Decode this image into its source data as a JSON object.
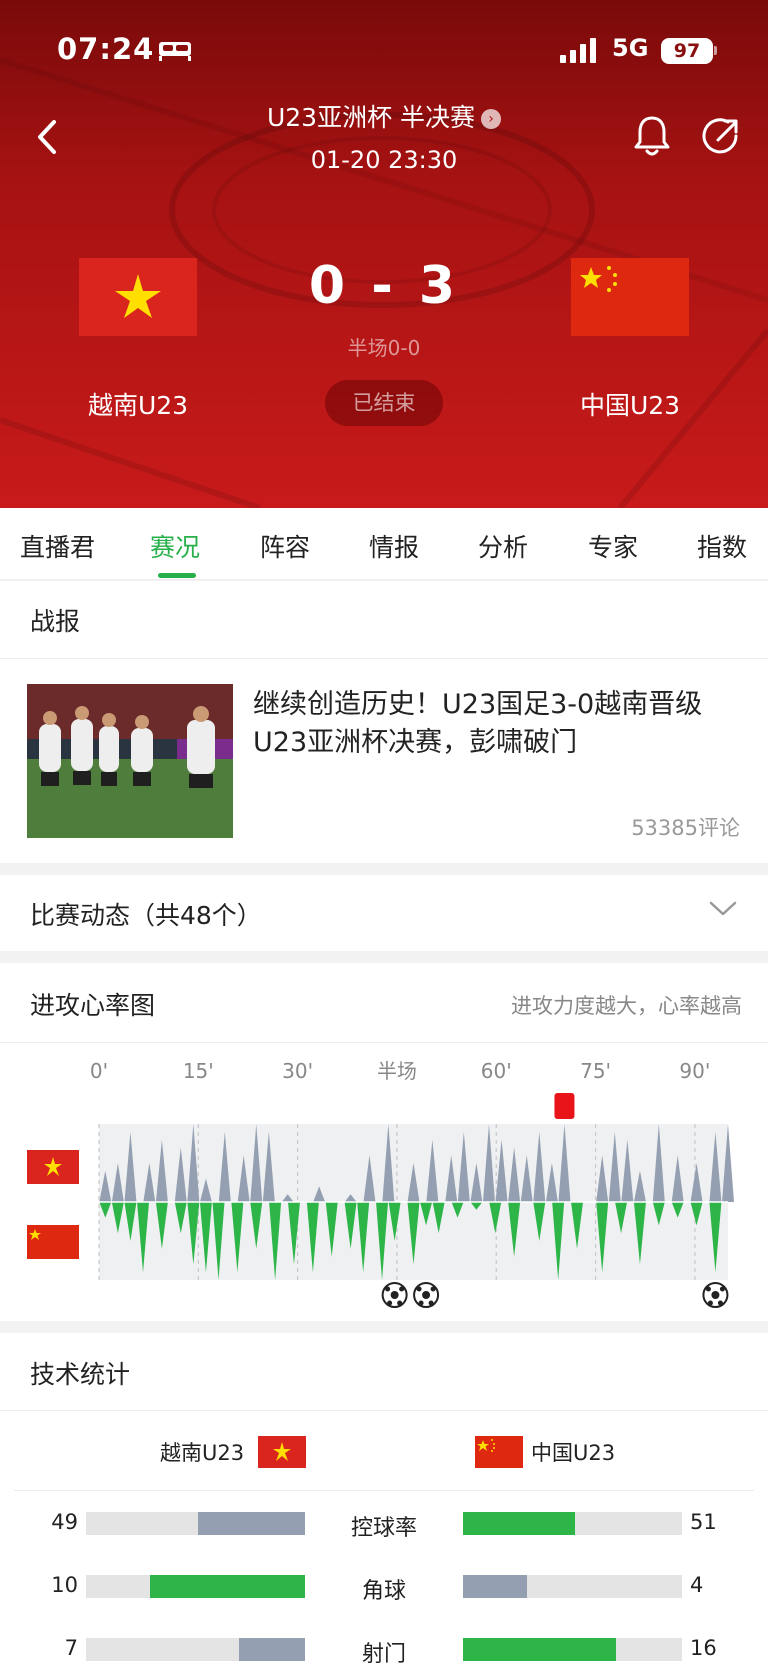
{
  "status_bar": {
    "time": "07:24",
    "network": "5G",
    "battery": "97"
  },
  "header": {
    "league": "U23亚洲杯 半决赛",
    "datetime": "01-20 23:30",
    "home_team": "越南U23",
    "away_team": "中国U23",
    "home_score": "0",
    "away_score": "3",
    "score_sep": "-",
    "halftime": "半场0-0",
    "match_status": "已结束"
  },
  "tabs": [
    "直播君",
    "赛况",
    "阵容",
    "情报",
    "分析",
    "专家",
    "指数"
  ],
  "active_tab": "赛况",
  "report": {
    "section_title": "战报",
    "headline": "继续创造历史！U23国足3-0越南晋级U23亚洲杯决赛，彭啸破门",
    "comments": "53385评论"
  },
  "dynamics": {
    "title": "比赛动态（共48个）"
  },
  "attack_chart": {
    "title": "进攻心率图",
    "subtitle": "进攻力度越大，心率越高",
    "time_labels": [
      "0'",
      "15'",
      "30'",
      "半场",
      "60'",
      "75'",
      "90'"
    ]
  },
  "chart_data": {
    "type": "area",
    "xlabel": "",
    "ylabel": "",
    "x_ticks": [
      "0'",
      "15'",
      "30'",
      "半场",
      "60'",
      "75'",
      "90'"
    ],
    "series": [
      {
        "x": [
          1,
          3,
          5,
          8,
          10,
          13,
          15,
          17,
          20,
          23,
          25,
          27,
          30,
          35,
          40,
          43,
          46,
          50,
          53,
          56,
          58,
          60,
          62,
          64,
          66,
          68,
          70,
          72,
          74,
          80,
          82,
          84,
          86,
          89,
          92,
          95,
          98,
          100
        ],
        "y": [
          0.4,
          0.5,
          0.9,
          0.5,
          0.8,
          0.7,
          1.0,
          0.3,
          0.9,
          0.6,
          1.0,
          0.9,
          0.1,
          0.2,
          0.1,
          0.6,
          1.0,
          0.5,
          0.8,
          0.6,
          0.9,
          0.5,
          1.0,
          0.8,
          0.7,
          0.6,
          0.9,
          0.5,
          1.0,
          0.6,
          0.9,
          0.8,
          0.4,
          1.0,
          0.6,
          0.5,
          0.9,
          1.0
        ]
      },
      {
        "x": [
          1,
          3,
          5,
          7,
          10,
          13,
          15,
          17,
          19,
          22,
          25,
          28,
          31,
          34,
          37,
          40,
          42,
          45,
          47,
          50,
          52,
          54,
          57,
          60,
          63,
          66,
          70,
          73,
          76,
          80,
          83,
          86,
          89,
          92,
          95,
          98
        ],
        "y": [
          0.2,
          0.4,
          0.5,
          0.9,
          0.6,
          0.4,
          0.8,
          0.9,
          1.0,
          0.9,
          0.6,
          1.0,
          0.8,
          0.9,
          0.7,
          0.6,
          0.9,
          1.0,
          0.5,
          0.8,
          0.3,
          0.4,
          0.2,
          0.1,
          0.4,
          0.7,
          0.5,
          1.0,
          0.6,
          0.9,
          0.4,
          0.8,
          0.3,
          0.2,
          0.3,
          0.9
        ]
      }
    ],
    "events": [
      {
        "type": "goal",
        "team": "away",
        "minute": 47
      },
      {
        "type": "goal",
        "team": "away",
        "minute": 52
      },
      {
        "type": "goal",
        "team": "away",
        "minute": 98
      },
      {
        "type": "red_card",
        "team": "home",
        "minute": 74
      }
    ]
  },
  "stats": {
    "title": "技术统计",
    "home_name": "越南U23",
    "away_name": "中国U23",
    "rows": [
      {
        "label": "控球率",
        "home": 49,
        "away": 51,
        "home_fill": 0.49,
        "away_fill": 0.51,
        "home_color": "#94a0b1",
        "away_color": "#2db548"
      },
      {
        "label": "角球",
        "home": 10,
        "away": 4,
        "home_fill": 0.71,
        "away_fill": 0.29,
        "home_color": "#2db548",
        "away_color": "#94a0b1"
      },
      {
        "label": "射门",
        "home": 7,
        "away": 16,
        "home_fill": 0.3,
        "away_fill": 0.7,
        "home_color": "#94a0b1",
        "away_color": "#2db548"
      }
    ]
  },
  "colors": {
    "accent": "#27b04a",
    "header_red": "#c81a1a",
    "grey_bar": "#94a0b1",
    "track": "#e4e4e4"
  }
}
